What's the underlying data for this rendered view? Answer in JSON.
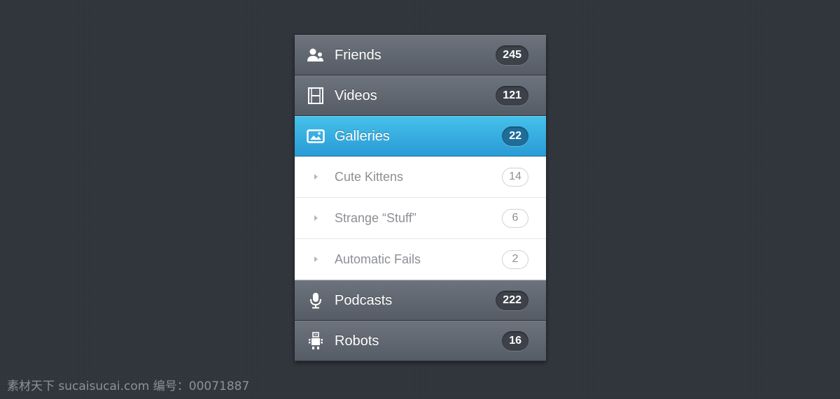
{
  "menu": {
    "items": [
      {
        "label": "Friends",
        "count": "245",
        "icon": "friends-icon",
        "state": "normal"
      },
      {
        "label": "Videos",
        "count": "121",
        "icon": "film-icon",
        "state": "normal"
      },
      {
        "label": "Galleries",
        "count": "22",
        "icon": "image-icon",
        "state": "active",
        "children": [
          {
            "label": "Cute Kittens",
            "count": "14"
          },
          {
            "label": "Strange “Stuff”",
            "count": "6"
          },
          {
            "label": "Automatic Fails",
            "count": "2"
          }
        ]
      },
      {
        "label": "Podcasts",
        "count": "222",
        "icon": "microphone-icon",
        "state": "normal"
      },
      {
        "label": "Robots",
        "count": "16",
        "icon": "robot-icon",
        "state": "normal"
      }
    ]
  },
  "colors": {
    "active": "#2ea6dd",
    "dark_item": "#60666f",
    "background": "#2f343b"
  },
  "watermark": "素材天下 sucaisucai.com  编号：00071887"
}
